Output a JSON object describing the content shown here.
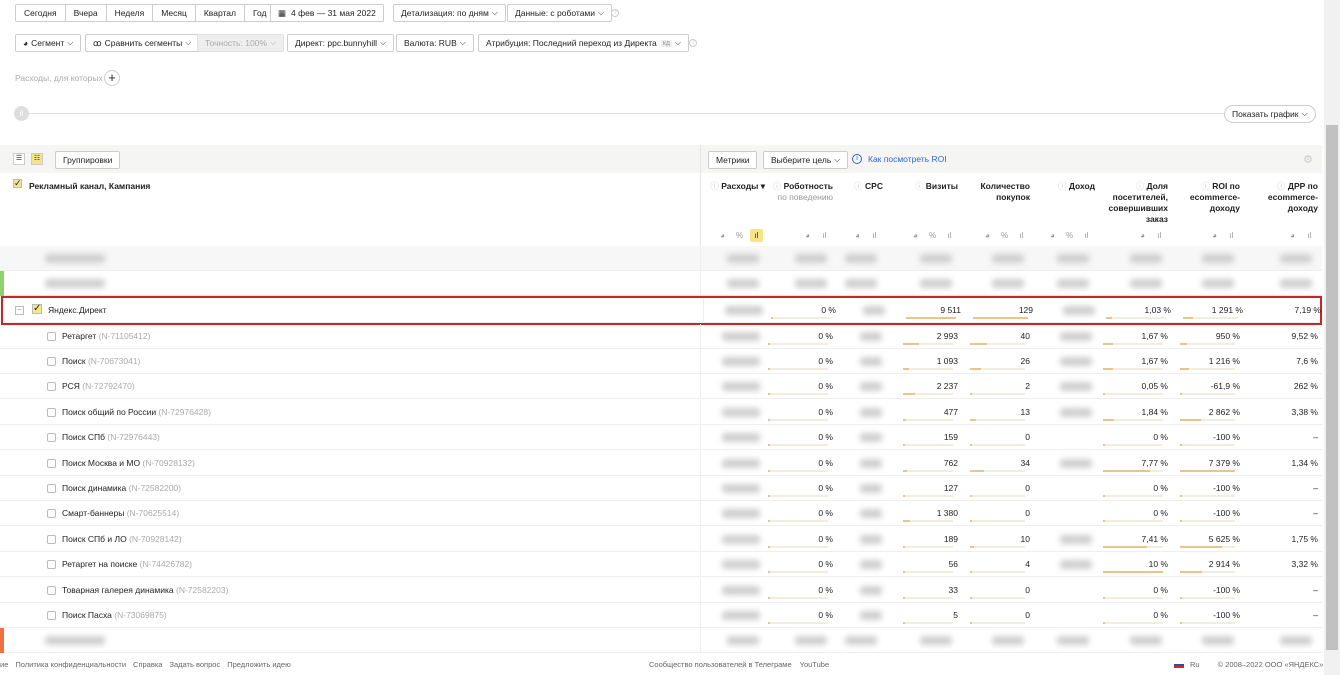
{
  "periods": [
    "Сегодня",
    "Вчера",
    "Неделя",
    "Месяц",
    "Квартал",
    "Год"
  ],
  "date_range": "4 фев — 31 мая 2022",
  "detail": "Детализация: по дням",
  "data_mode": "Данные: с роботами",
  "segment": "Сегмент",
  "compare": "Сравнить сегменты",
  "accuracy": "Точность: 100%",
  "direct": "Директ: ppc.bunnyhill",
  "currency": "Валюта: RUB",
  "attribution": "Атрибуция: Последний переход из Директа",
  "attribution_badge": "кд",
  "expenses_filter": "Расходы, для которых",
  "show_chart": "Показать график",
  "groupings": "Группировки",
  "metrics": "Метрики",
  "goal": "Выберите цель",
  "roi_link": "Как посмотреть ROI",
  "dim_header": "Рекламный канал, Кампания",
  "columns": [
    {
      "title": "Расходы",
      "sub": ""
    },
    {
      "title": "Роботность",
      "sub": "по поведению"
    },
    {
      "title": "CPC",
      "sub": ""
    },
    {
      "title": "Визиты",
      "sub": ""
    },
    {
      "title": "Количество покупок",
      "sub": ""
    },
    {
      "title": "Доход",
      "sub": ""
    },
    {
      "title": "Доля посетителей, совершивших заказ",
      "sub": ""
    },
    {
      "title": "ROI по ecommerce-доходу",
      "sub": ""
    },
    {
      "title": "ДРР по ecommerce-доходу",
      "sub": ""
    }
  ],
  "parent": {
    "name": "Яндекс.Директ",
    "robot": "0 %",
    "visits": "9 511",
    "purchases": "129",
    "share": "1,03 %",
    "roi": "1 291 %",
    "drr": "7,19 %"
  },
  "rows": [
    {
      "name": "Ретаргет",
      "id": "(N-71105412)",
      "robot": "0 %",
      "visits": "2 993",
      "purchases": "40",
      "share": "1,67 %",
      "roi": "950 %",
      "drr": "9,52 %"
    },
    {
      "name": "Поиск",
      "id": "(N-70673041)",
      "robot": "0 %",
      "visits": "1 093",
      "purchases": "26",
      "share": "1,67 %",
      "roi": "1 216 %",
      "drr": "7,6 %"
    },
    {
      "name": "РСЯ",
      "id": "(N-72792470)",
      "robot": "0 %",
      "visits": "2 237",
      "purchases": "2",
      "share": "0,05 %",
      "roi": "-61,9 %",
      "drr": "262 %"
    },
    {
      "name": "Поиск общий по России",
      "id": "(N-72976428)",
      "robot": "0 %",
      "visits": "477",
      "purchases": "13",
      "share": "1,84 %",
      "roi": "2 862 %",
      "drr": "3,38 %"
    },
    {
      "name": "Поиск СПб",
      "id": "(N-72976443)",
      "robot": "0 %",
      "visits": "159",
      "purchases": "0",
      "share": "0 %",
      "roi": "-100 %",
      "drr": "–"
    },
    {
      "name": "Поиск Москва и МО",
      "id": "(N-70928132)",
      "robot": "0 %",
      "visits": "762",
      "purchases": "34",
      "share": "7,77 %",
      "roi": "7 379 %",
      "drr": "1,34 %"
    },
    {
      "name": "Поиск динамика",
      "id": "(N-72582200)",
      "robot": "0 %",
      "visits": "127",
      "purchases": "0",
      "share": "0 %",
      "roi": "-100 %",
      "drr": "–"
    },
    {
      "name": "Смарт-баннеры",
      "id": "(N-70625514)",
      "robot": "0 %",
      "visits": "1 380",
      "purchases": "0",
      "share": "0 %",
      "roi": "-100 %",
      "drr": "–"
    },
    {
      "name": "Поиск СПб и ЛО",
      "id": "(N-70928142)",
      "robot": "0 %",
      "visits": "189",
      "purchases": "10",
      "share": "7,41 %",
      "roi": "5 625 %",
      "drr": "1,75 %"
    },
    {
      "name": "Ретаргет на поиске",
      "id": "(N-74426782)",
      "robot": "0 %",
      "visits": "56",
      "purchases": "4",
      "share": "10 %",
      "roi": "2 914 %",
      "drr": "3,32 %"
    },
    {
      "name": "Товарная галерея динамика",
      "id": "(N-72582203)",
      "robot": "0 %",
      "visits": "33",
      "purchases": "0",
      "share": "0 %",
      "roi": "-100 %",
      "drr": "–"
    },
    {
      "name": "Поиск Пасха",
      "id": "(N-73069875)",
      "robot": "0 %",
      "visits": "5",
      "purchases": "0",
      "share": "0 %",
      "roi": "-100 %",
      "drr": "–"
    }
  ],
  "footer_left": [
    "ие",
    "Политика конфиденциальности",
    "Справка",
    "Задать вопрос",
    "Предложить идею"
  ],
  "footer_mid": [
    "Сообщество пользователей в Телеграме",
    "YouTube"
  ],
  "lang": "Ru",
  "copyright": "© 2008–2022 ООО «ЯНДЕКС»",
  "colors": {
    "highlight": "#c0282d",
    "accent_bar": "#e8c58e",
    "link": "#3366cc"
  }
}
